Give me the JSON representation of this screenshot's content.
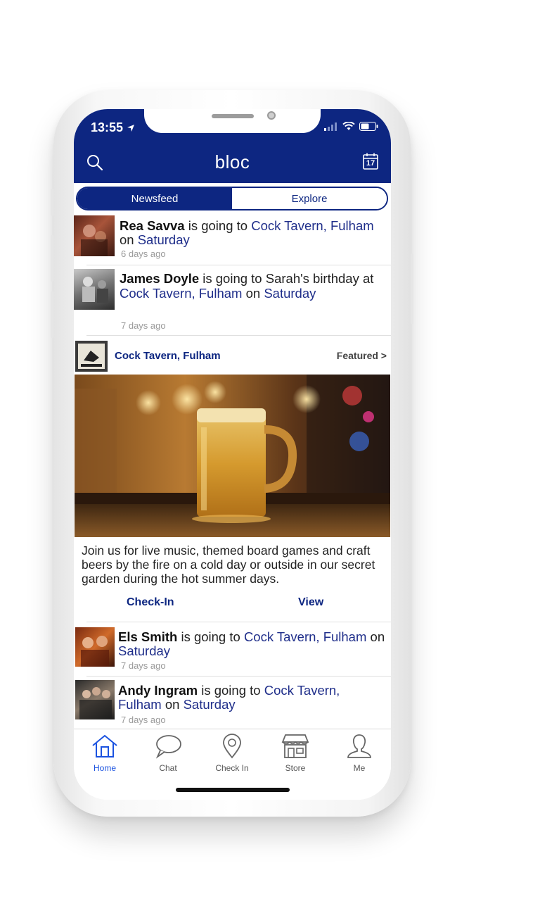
{
  "status_bar": {
    "time": "13:55"
  },
  "header": {
    "title": "bloc",
    "calendar_day": "17"
  },
  "segment": {
    "tabs": [
      {
        "label": "Newsfeed",
        "active": true
      },
      {
        "label": "Explore",
        "active": false
      }
    ]
  },
  "feed": [
    {
      "name": "Rea Savva",
      "verb": " is going to ",
      "venue": "Cock Tavern, Fulham",
      "on": " on ",
      "day": "Saturday",
      "ago": "6 days ago"
    },
    {
      "name": "James Doyle",
      "verb": " is going to Sarah's birthday at ",
      "venue": "Cock Tavern, Fulham",
      "on": " on ",
      "day": "Saturday",
      "ago": "7 days ago"
    }
  ],
  "featured_card": {
    "venue": "Cock Tavern, Fulham",
    "featured_label": "Featured >",
    "description": "Join us for live music, themed board games and craft beers by the fire on a cold day or outside in our secret garden during the hot summer days.",
    "checkin_label": "Check-In",
    "view_label": "View"
  },
  "feed2": [
    {
      "name": "Els Smith",
      "verb": " is going to ",
      "venue": "Cock Tavern, Fulham",
      "on": " on ",
      "day": "Saturday",
      "ago": "7 days ago"
    },
    {
      "name": "Andy Ingram",
      "verb": " is going to ",
      "venue": "Cock Tavern, Fulham",
      "on": " on ",
      "day": "Saturday",
      "ago": "7 days ago"
    }
  ],
  "tabbar": {
    "items": [
      {
        "label": "Home",
        "icon": "home-icon",
        "active": true
      },
      {
        "label": "Chat",
        "icon": "chat-icon",
        "active": false
      },
      {
        "label": "Check In",
        "icon": "checkin-pin-icon",
        "active": false
      },
      {
        "label": "Store",
        "icon": "store-icon",
        "active": false
      },
      {
        "label": "Me",
        "icon": "person-icon",
        "active": false
      }
    ]
  },
  "colors": {
    "brand": "#0d2681",
    "active_tab": "#1a52e0",
    "link": "#1f2e8a"
  }
}
